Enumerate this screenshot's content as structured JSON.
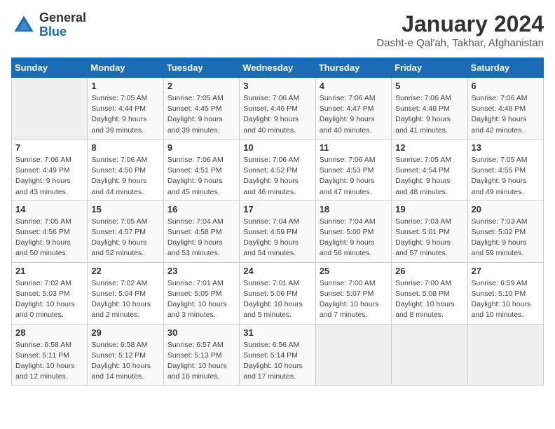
{
  "header": {
    "logo_general": "General",
    "logo_blue": "Blue",
    "title": "January 2024",
    "subtitle": "Dasht-e Qal'ah, Takhar, Afghanistan"
  },
  "calendar": {
    "days_of_week": [
      "Sunday",
      "Monday",
      "Tuesday",
      "Wednesday",
      "Thursday",
      "Friday",
      "Saturday"
    ],
    "weeks": [
      [
        {
          "day": "",
          "info": ""
        },
        {
          "day": "1",
          "info": "Sunrise: 7:05 AM\nSunset: 4:44 PM\nDaylight: 9 hours\nand 39 minutes."
        },
        {
          "day": "2",
          "info": "Sunrise: 7:05 AM\nSunset: 4:45 PM\nDaylight: 9 hours\nand 39 minutes."
        },
        {
          "day": "3",
          "info": "Sunrise: 7:06 AM\nSunset: 4:46 PM\nDaylight: 9 hours\nand 40 minutes."
        },
        {
          "day": "4",
          "info": "Sunrise: 7:06 AM\nSunset: 4:47 PM\nDaylight: 9 hours\nand 40 minutes."
        },
        {
          "day": "5",
          "info": "Sunrise: 7:06 AM\nSunset: 4:48 PM\nDaylight: 9 hours\nand 41 minutes."
        },
        {
          "day": "6",
          "info": "Sunrise: 7:06 AM\nSunset: 4:48 PM\nDaylight: 9 hours\nand 42 minutes."
        }
      ],
      [
        {
          "day": "7",
          "info": "Sunrise: 7:06 AM\nSunset: 4:49 PM\nDaylight: 9 hours\nand 43 minutes."
        },
        {
          "day": "8",
          "info": "Sunrise: 7:06 AM\nSunset: 4:50 PM\nDaylight: 9 hours\nand 44 minutes."
        },
        {
          "day": "9",
          "info": "Sunrise: 7:06 AM\nSunset: 4:51 PM\nDaylight: 9 hours\nand 45 minutes."
        },
        {
          "day": "10",
          "info": "Sunrise: 7:06 AM\nSunset: 4:52 PM\nDaylight: 9 hours\nand 46 minutes."
        },
        {
          "day": "11",
          "info": "Sunrise: 7:06 AM\nSunset: 4:53 PM\nDaylight: 9 hours\nand 47 minutes."
        },
        {
          "day": "12",
          "info": "Sunrise: 7:05 AM\nSunset: 4:54 PM\nDaylight: 9 hours\nand 48 minutes."
        },
        {
          "day": "13",
          "info": "Sunrise: 7:05 AM\nSunset: 4:55 PM\nDaylight: 9 hours\nand 49 minutes."
        }
      ],
      [
        {
          "day": "14",
          "info": "Sunrise: 7:05 AM\nSunset: 4:56 PM\nDaylight: 9 hours\nand 50 minutes."
        },
        {
          "day": "15",
          "info": "Sunrise: 7:05 AM\nSunset: 4:57 PM\nDaylight: 9 hours\nand 52 minutes."
        },
        {
          "day": "16",
          "info": "Sunrise: 7:04 AM\nSunset: 4:58 PM\nDaylight: 9 hours\nand 53 minutes."
        },
        {
          "day": "17",
          "info": "Sunrise: 7:04 AM\nSunset: 4:59 PM\nDaylight: 9 hours\nand 54 minutes."
        },
        {
          "day": "18",
          "info": "Sunrise: 7:04 AM\nSunset: 5:00 PM\nDaylight: 9 hours\nand 56 minutes."
        },
        {
          "day": "19",
          "info": "Sunrise: 7:03 AM\nSunset: 5:01 PM\nDaylight: 9 hours\nand 57 minutes."
        },
        {
          "day": "20",
          "info": "Sunrise: 7:03 AM\nSunset: 5:02 PM\nDaylight: 9 hours\nand 59 minutes."
        }
      ],
      [
        {
          "day": "21",
          "info": "Sunrise: 7:02 AM\nSunset: 5:03 PM\nDaylight: 10 hours\nand 0 minutes."
        },
        {
          "day": "22",
          "info": "Sunrise: 7:02 AM\nSunset: 5:04 PM\nDaylight: 10 hours\nand 2 minutes."
        },
        {
          "day": "23",
          "info": "Sunrise: 7:01 AM\nSunset: 5:05 PM\nDaylight: 10 hours\nand 3 minutes."
        },
        {
          "day": "24",
          "info": "Sunrise: 7:01 AM\nSunset: 5:06 PM\nDaylight: 10 hours\nand 5 minutes."
        },
        {
          "day": "25",
          "info": "Sunrise: 7:00 AM\nSunset: 5:07 PM\nDaylight: 10 hours\nand 7 minutes."
        },
        {
          "day": "26",
          "info": "Sunrise: 7:00 AM\nSunset: 5:08 PM\nDaylight: 10 hours\nand 8 minutes."
        },
        {
          "day": "27",
          "info": "Sunrise: 6:59 AM\nSunset: 5:10 PM\nDaylight: 10 hours\nand 10 minutes."
        }
      ],
      [
        {
          "day": "28",
          "info": "Sunrise: 6:58 AM\nSunset: 5:11 PM\nDaylight: 10 hours\nand 12 minutes."
        },
        {
          "day": "29",
          "info": "Sunrise: 6:58 AM\nSunset: 5:12 PM\nDaylight: 10 hours\nand 14 minutes."
        },
        {
          "day": "30",
          "info": "Sunrise: 6:57 AM\nSunset: 5:13 PM\nDaylight: 10 hours\nand 16 minutes."
        },
        {
          "day": "31",
          "info": "Sunrise: 6:56 AM\nSunset: 5:14 PM\nDaylight: 10 hours\nand 17 minutes."
        },
        {
          "day": "",
          "info": ""
        },
        {
          "day": "",
          "info": ""
        },
        {
          "day": "",
          "info": ""
        }
      ]
    ]
  }
}
